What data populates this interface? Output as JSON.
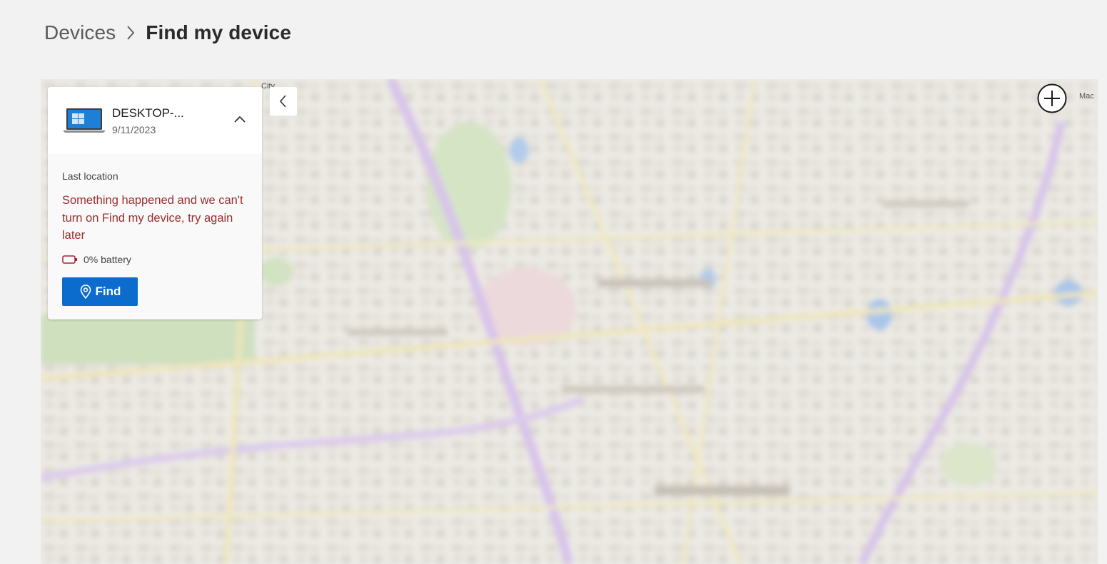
{
  "breadcrumb": {
    "parent": "Devices",
    "current": "Find my device"
  },
  "device": {
    "name": "DESKTOP-...",
    "date": "9/11/2023",
    "last_location_label": "Last location",
    "error_message": "Something happened and we can't turn on Find my device, try again later",
    "battery": "0% battery",
    "find_label": "Find"
  },
  "map_labels": {
    "top_right": "Mac",
    "top_left": "City"
  },
  "icons": {
    "breadcrumb_separator": "chevron-right-icon",
    "device": "laptop-icon",
    "expand_toggle": "chevron-up-icon",
    "battery": "battery-empty-icon",
    "find": "location-pin-icon",
    "collapse_panel": "chevron-left-icon",
    "zoom": "plus-circle-icon"
  },
  "colors": {
    "accent": "#0b6cce",
    "error": "#9a2d2d",
    "battery_empty": "#a4262c",
    "background": "#f2f2f2"
  }
}
